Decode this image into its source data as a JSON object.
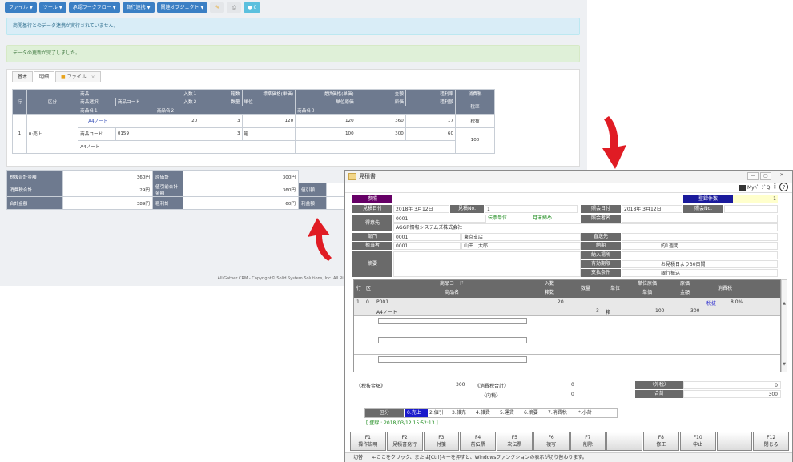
{
  "web": {
    "toolbar": [
      {
        "label": "ファイル",
        "caret": true
      },
      {
        "label": "ツール",
        "caret": true
      },
      {
        "label": "承認ワークフロー",
        "caret": true
      },
      {
        "label": "各行連携",
        "caret": true
      },
      {
        "label": "関連オブジェクト",
        "caret": true
      }
    ],
    "toolbar_icons": [
      "pencil-icon",
      "print-icon"
    ],
    "comment_count": "0",
    "alert_info": "商閲基行とのデータ連携が実行されていません。",
    "alert_success": "データの更新が完了しました。",
    "tabs": [
      "基本",
      "明細",
      "ファイル"
    ],
    "grid": {
      "h1": [
        "行",
        "区分",
        "商品",
        "",
        "入数１",
        "箱数",
        "標準価格(単価)",
        "提供価格(単価)",
        "金額",
        "粗利率",
        "消費税"
      ],
      "h2": [
        "",
        "",
        "商品選択",
        "商品コード",
        "入数２",
        "数量",
        "単位",
        "単位原価",
        "原価",
        "粗利額",
        "税率"
      ],
      "h3": [
        "",
        "",
        "商品名１",
        "",
        "商品名２",
        "",
        "",
        "商品名３",
        "",
        "",
        ""
      ],
      "row": {
        "no": "1",
        "kubun": "0:売上",
        "name1": "A4ノート",
        "irisu1": "20",
        "hako": "3",
        "std_price": "120",
        "offer_price": "120",
        "amount": "360",
        "margin_rate": "17",
        "tax": "税抜",
        "code_label": "商品コード",
        "code": "0159",
        "qty": "3",
        "unit": "箱",
        "unit_cost": "100",
        "cost": "300",
        "margin": "60",
        "tax_rate": "100",
        "name_item": "A4ノート"
      }
    },
    "summary": [
      [
        "税抜合計金額",
        "360円",
        "原価計",
        "300円",
        "",
        ""
      ],
      [
        "消費税合計",
        "29円",
        "値引前合計金額",
        "360円",
        "値引額",
        ""
      ],
      [
        "合計金額",
        "389円",
        "粗利計",
        "60円",
        "利益額",
        ""
      ]
    ],
    "footer": "All Gather CRM - Copyright© Solid System Solutions, Inc. All Right"
  },
  "win": {
    "title": "見積書",
    "mypage": "MyﾍﾟｰｼﾞQ",
    "form": {
      "sanshou": "参照",
      "touroku": "登録件数",
      "count": "1",
      "mitsumori_date_label": "見積日付",
      "mitsumori_date": "2018年 3月12日",
      "mitsumori_no_label": "見積No.",
      "mitsumori_no": "1",
      "shoukai_date_label": "照会日付",
      "shoukai_date": "2018年 3月12日",
      "shoukai_no_label": "照会No.",
      "tokui_label": "得意先",
      "tokui_code": "0001",
      "tokui_name": "AGGR情報システムズ株式会社",
      "denpyo": "伝票単位",
      "shime": "月末締め",
      "shoukai_name_label": "照会者名",
      "bumon_label": "部門",
      "bumon_code": "0001",
      "bumon_name": "東京支店",
      "chokuso_label": "直送先",
      "tantou_label": "担当者",
      "tantou_code": "0001",
      "tantou_name": "山田　太郎",
      "nouki_label": "納期",
      "nouki": "約1週間",
      "tekiyou_label": "摘要",
      "basho_label": "納入場所",
      "yukou_label": "有効期限",
      "yukou": "お見積日より30日間",
      "shiharai_label": "支払条件",
      "shiharai": "銀行振込"
    },
    "grid": {
      "h_gyo": "行",
      "h_ku": "区",
      "h_code": "商品コード",
      "h_name": "商品名",
      "h_irisu": "入数",
      "h_hako": "箱数",
      "h_qty": "数量",
      "h_unit": "単位",
      "h_unitprice1": "単位原価",
      "h_unitprice2": "単価",
      "h_cost1": "原価",
      "h_cost2": "金額",
      "h_tax": "消費税",
      "row": {
        "no": "1",
        "ku": "0",
        "code": "P001",
        "name": "A4ノート",
        "irisu": "20",
        "qty": "3",
        "unit": "箱",
        "price": "100",
        "amount": "300",
        "tax_type": "税抜",
        "tax_rate": "8.0%"
      }
    },
    "totals": {
      "zeinuki_label": "《税抜金額》",
      "zeinuki": "300",
      "shouhi_label": "《消費税合計》",
      "shouhi": "0",
      "uchizei_label": "〈内税〉",
      "uchizei": "0",
      "sotozei_label": "〈外税〉",
      "sotozei": "0",
      "goukei_label": "合計",
      "goukei": "300"
    },
    "kubun_label": "区分",
    "kubun_items": [
      "0.売上",
      "2.値引",
      "3.雑売",
      "4.雑費",
      "5.運賃",
      "6.摘要",
      "7.消費税",
      "*.小計"
    ],
    "registered": "[ 登録 :  2018/03/12 15:52:13 ]",
    "fkeys": [
      {
        "k": "F1",
        "l": "操作説明"
      },
      {
        "k": "F2",
        "l": "見積書発行"
      },
      {
        "k": "F3",
        "l": "付箋"
      },
      {
        "k": "F4",
        "l": "前伝票"
      },
      {
        "k": "F5",
        "l": "次伝票"
      },
      {
        "k": "F6",
        "l": "複写"
      },
      {
        "k": "F7",
        "l": "削除"
      },
      {
        "k": "",
        "l": "",
        "dis": true
      },
      {
        "k": "F8",
        "l": "修正"
      },
      {
        "k": "F10",
        "l": "中止"
      },
      {
        "k": "",
        "l": "",
        "dis": true
      },
      {
        "k": "F12",
        "l": "閉じる"
      }
    ],
    "status": "切替　　←ここをクリック、または[Ctrl]キーを押すと、Windowsファンクションの表示が切り替わります。"
  },
  "colors": {
    "primary": "#3b7fc4",
    "header": "#6e7a8f",
    "arrow": "#e01c24"
  }
}
